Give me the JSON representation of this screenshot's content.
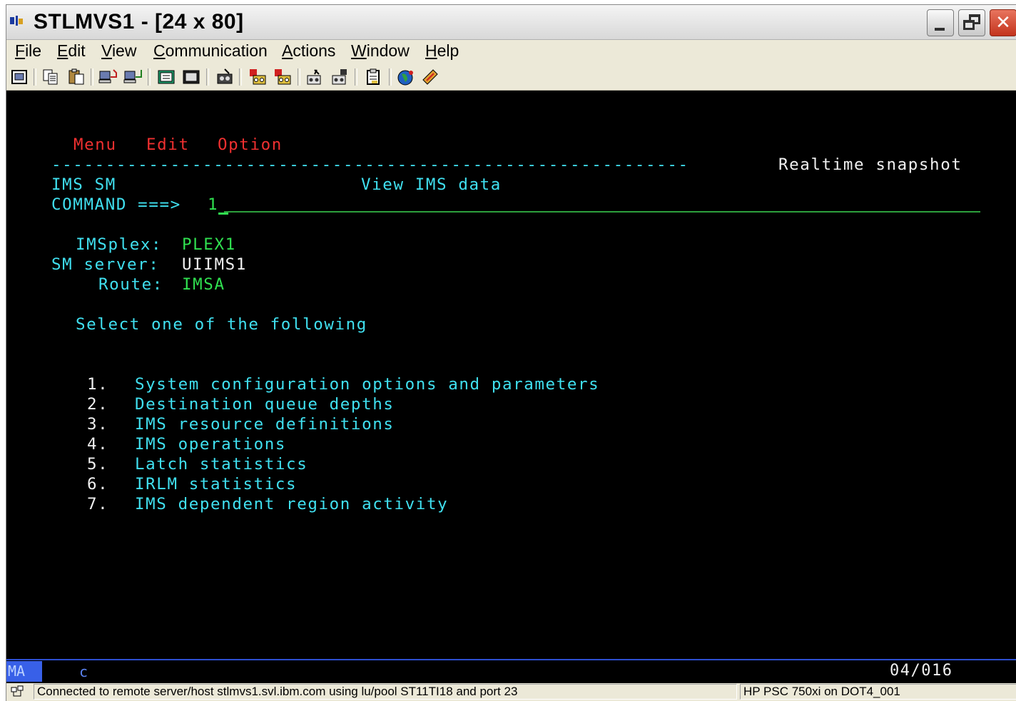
{
  "window": {
    "title": "STLMVS1 - [24 x 80]",
    "buttons": {
      "minimize": "minimize",
      "maximize": "restore",
      "close": "close"
    }
  },
  "menubar": {
    "items": [
      {
        "label": "File",
        "mnemonic": "F"
      },
      {
        "label": "Edit",
        "mnemonic": "E"
      },
      {
        "label": "View",
        "mnemonic": "V"
      },
      {
        "label": "Communication",
        "mnemonic": "C"
      },
      {
        "label": "Actions",
        "mnemonic": "A"
      },
      {
        "label": "Window",
        "mnemonic": "W"
      },
      {
        "label": "Help",
        "mnemonic": "H"
      }
    ]
  },
  "toolbar": {
    "icons": [
      "print-screen-icon",
      "copy-icon",
      "paste-icon",
      "send-file-icon",
      "receive-file-icon",
      "display-keypad-icon",
      "keypad-icon",
      "record-macro-icon",
      "play-macro-icon",
      "stop-macro-icon",
      "macro-run-icon",
      "macro-stop-icon",
      "clipboard-icon",
      "customize-colors-icon",
      "map-keyboard-icon"
    ]
  },
  "screen": {
    "action_bar": [
      "Menu",
      "Edit",
      "Option"
    ],
    "dash_line": "-----------------------------------------------------------",
    "header_right": "Realtime snapshot",
    "app_name": "IMS SM",
    "panel_title": "View IMS data",
    "command_label": "COMMAND ===>",
    "command_value": "1",
    "imsplex_label": "IMSplex:",
    "imsplex_value": "PLEX1",
    "sm_server_label": "SM server:",
    "sm_server_value": "UIIMS1",
    "route_label": "Route:",
    "route_value": "IMSA",
    "instruction": "Select one of the following",
    "options": [
      {
        "num": "1.",
        "label": "System configuration options and parameters"
      },
      {
        "num": "2.",
        "label": "Destination queue depths"
      },
      {
        "num": "3.",
        "label": "IMS resource definitions"
      },
      {
        "num": "4.",
        "label": "IMS operations"
      },
      {
        "num": "5.",
        "label": "Latch statistics"
      },
      {
        "num": "6.",
        "label": "IRLM statistics"
      },
      {
        "num": "7.",
        "label": "IMS dependent region activity"
      }
    ]
  },
  "oia": {
    "mode": "MA",
    "indicator": "c",
    "cursor_position": "04/016"
  },
  "statusbar": {
    "connection": "Connected to remote server/host stlmvs1.svl.ibm.com using lu/pool ST11TI18 and port 23",
    "printer": "HP PSC 750xi on DOT4_001"
  }
}
